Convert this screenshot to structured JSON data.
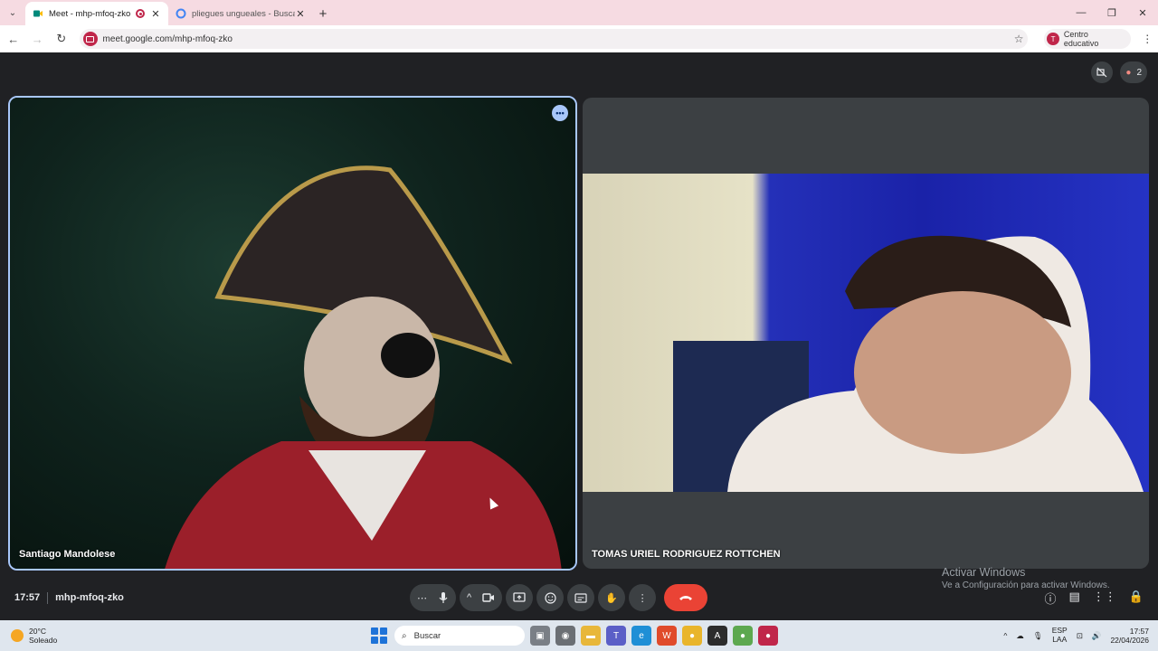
{
  "browser": {
    "tabs": [
      {
        "title": "Meet - mhp-mfoq-zko",
        "active": true
      },
      {
        "title": "pliegues ungueales - Buscar con Google",
        "active": false
      }
    ],
    "url": "meet.google.com/mhp-mfoq-zko",
    "profile_initial": "T",
    "profile_label": "Centro educativo",
    "accent": "#c0264a"
  },
  "meet": {
    "participant_count": "2",
    "participants": [
      {
        "name": "Santiago Mandolese"
      },
      {
        "name": "TOMAS URIEL RODRIGUEZ ROTTCHEN"
      }
    ],
    "time": "17:57",
    "meeting_code": "mhp-mfoq-zko",
    "controls": [
      "more-options",
      "microphone",
      "camera-options",
      "camera",
      "present-screen",
      "reactions",
      "captions",
      "raise-hand",
      "more-actions",
      "leave-call"
    ],
    "watermark_line1": "Activar Windows",
    "watermark_line2": "Ve a Configuración para activar Windows."
  },
  "taskbar": {
    "temperature": "20°C",
    "weather": "Soleado",
    "search_placeholder": "Buscar",
    "lang_line1": "ESP",
    "lang_line2": "LAA",
    "clock_time": "17:57",
    "clock_date": "22/04/2026"
  }
}
